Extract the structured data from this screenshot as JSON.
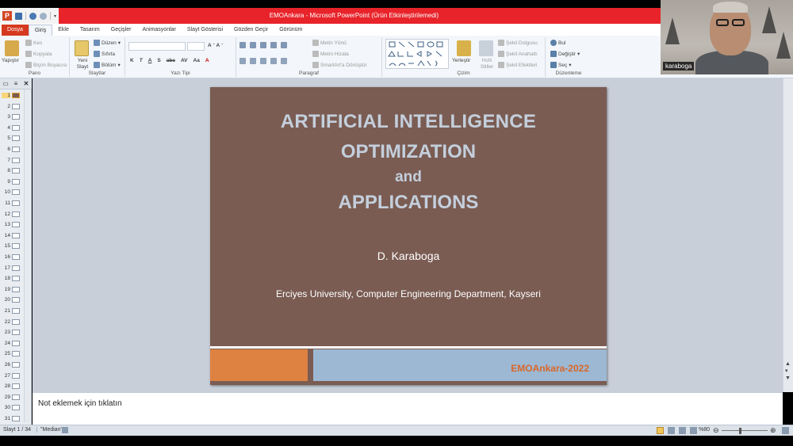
{
  "window": {
    "title": "EMOAnkara - Microsoft PowerPoint (Ürün Etkinleştirilemedi)",
    "app_logo": "P"
  },
  "menu": {
    "tabs": [
      "Dosya",
      "Giriş",
      "Ekle",
      "Tasarım",
      "Geçişler",
      "Animasyonlar",
      "Slayt Gösterisi",
      "Gözden Geçir",
      "Görünüm"
    ],
    "active_tab": "Giriş"
  },
  "ribbon": {
    "pano": {
      "name": "Pano",
      "paste": "Yapıştır",
      "cut": "Kes",
      "copy": "Kopyala",
      "format_painter": "Biçim Boyacısı"
    },
    "slaytlar": {
      "name": "Slaytlar",
      "new_slide": "Yeni Slayt",
      "layout": "Düzen",
      "reset": "Sıfırla",
      "section": "Bölüm"
    },
    "yazi_tipi": {
      "name": "Yazı Tipi",
      "font_value": "",
      "size_value": "",
      "buttons": [
        "K",
        "T",
        "A",
        "S",
        "abc",
        "AV",
        "Aa",
        "A"
      ]
    },
    "paragraf": {
      "name": "Paragraf",
      "text_direction": "Metin Yönü",
      "align_text": "Metni Hizala",
      "smartart": "SmartArt'a Dönüştür"
    },
    "cizim": {
      "name": "Çizim",
      "arrange": "Yerleştir",
      "quick_styles": "Hızlı Stiller",
      "shape_fill": "Şekil Dolgusu",
      "shape_outline": "Şekil Anahattı",
      "shape_effects": "Şekil Efektleri"
    },
    "duzenleme": {
      "name": "Düzenleme",
      "find": "Bul",
      "replace": "Değiştir",
      "select": "Seç"
    }
  },
  "slide_panel": {
    "numbers": [
      "1",
      "2",
      "3",
      "4",
      "5",
      "6",
      "7",
      "8",
      "9",
      "10",
      "11",
      "12",
      "13",
      "14",
      "15",
      "16",
      "17",
      "18",
      "19",
      "20",
      "21",
      "22",
      "23",
      "24",
      "25",
      "26",
      "27",
      "28",
      "29",
      "30",
      "31"
    ],
    "selected": "1"
  },
  "slide": {
    "title_line1": "ARTIFICIAL INTELLIGENCE",
    "title_line2": "OPTIMIZATION",
    "title_line3": "and",
    "title_line4": "APPLICATIONS",
    "author": "D. Karaboga",
    "affiliation": "Erciyes University, Computer Engineering Department, Kayseri",
    "footer": "EMOAnkara-2022",
    "colors": {
      "background": "#7a5c53",
      "title": "#c4cfdc",
      "orange": "#de8242",
      "blue": "#9db8d2",
      "footer_text": "#d9672b"
    }
  },
  "notes": {
    "placeholder": "Not eklemek için tıklatın"
  },
  "status": {
    "slide_info": "Slayt 1 / 34",
    "theme": "\"Median\"",
    "zoom": "%80"
  },
  "webcam": {
    "name": "karaboga"
  }
}
